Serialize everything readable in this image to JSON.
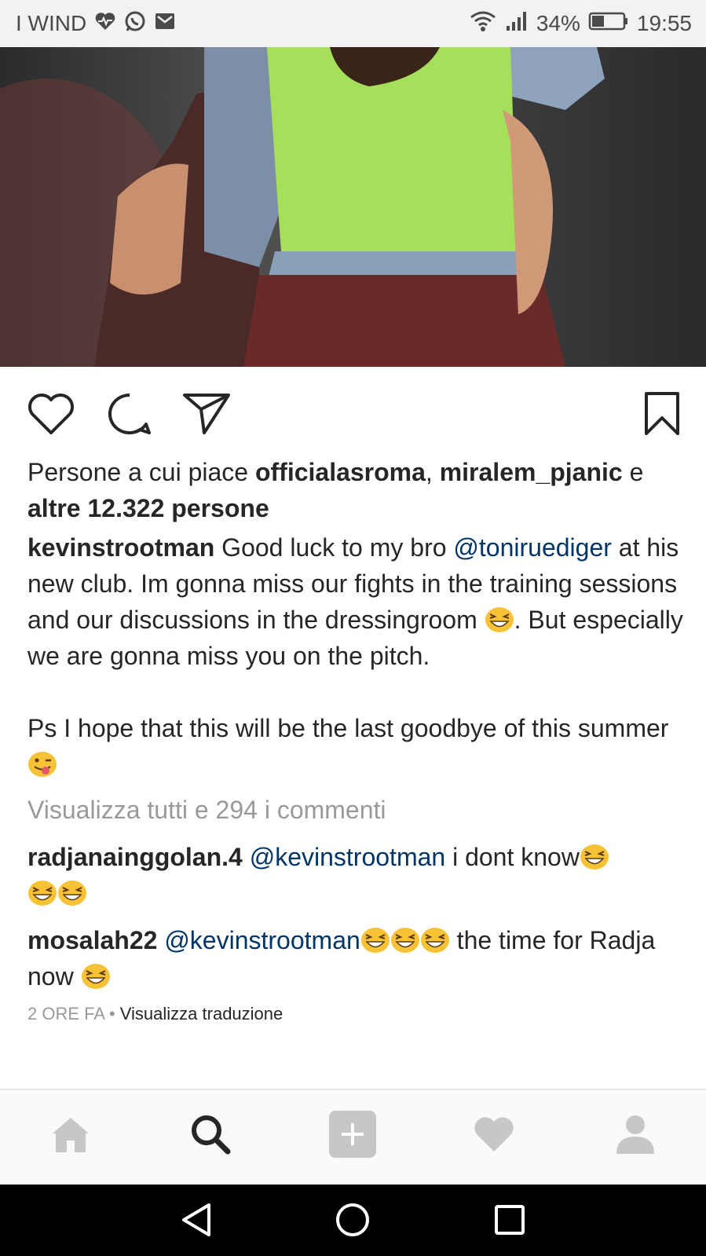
{
  "status_bar": {
    "carrier": "I WIND",
    "battery": "34%",
    "time": "19:55"
  },
  "post": {
    "likes": {
      "prefix": "Persone a cui piace ",
      "user1": "officialasroma",
      "sep": ", ",
      "user2": "miralem_pjanic",
      "and": " e",
      "others": "altre 12.322 persone"
    },
    "caption": {
      "author": "kevinstrootman",
      "part1": " Good luck to my bro ",
      "mention": "@toniruediger",
      "part2": " at his new club. Im gonna miss our fights in the training sessions  and our discussions in the dressingroom ",
      "part3": ". But especially we are gonna miss you on the pitch.",
      "part4": "Ps I hope that this will be the last goodbye of this summer"
    },
    "view_all_comments": "Visualizza tutti e 294 i commenti",
    "comments": [
      {
        "user": "radjanainggolan.4",
        "mention": "@kevinstrootman",
        "text": " i dont know"
      },
      {
        "user": "mosalah22",
        "mention": "@kevinstrootman",
        "text": " the time for Radja now "
      }
    ],
    "time_ago": "2 ORE FA",
    "dot": " • ",
    "translate": "Visualizza traduzione"
  },
  "icons": {
    "like": "heart-outline-icon",
    "comment": "comment-bubble-icon",
    "share": "paper-plane-icon",
    "save": "bookmark-icon",
    "nav": [
      "home-icon",
      "search-icon",
      "add-icon",
      "heart-icon",
      "profile-icon"
    ]
  },
  "colors": {
    "mention": "#003569",
    "muted": "#999999",
    "text": "#262626"
  }
}
